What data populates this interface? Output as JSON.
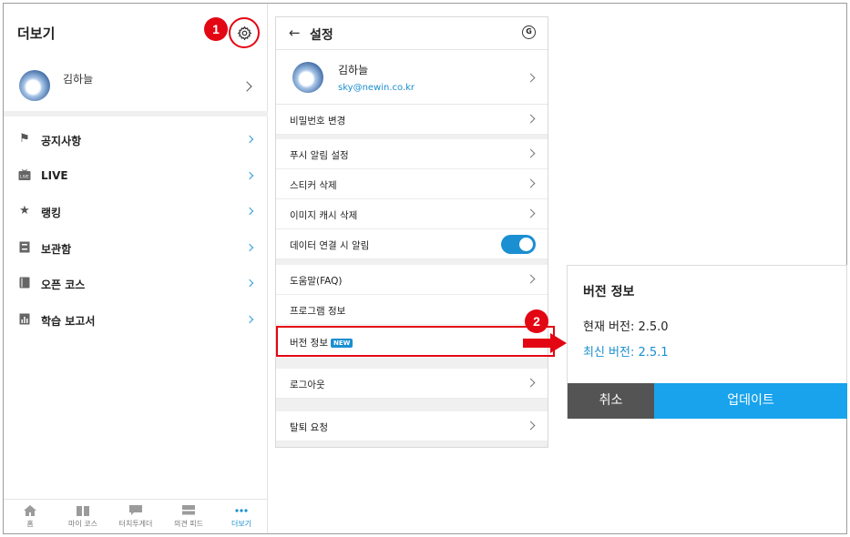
{
  "left": {
    "title": "더보기",
    "profile_name": "김하늘",
    "menu": [
      {
        "label": "공지사항",
        "icon": "flag-icon"
      },
      {
        "label": "LIVE",
        "icon": "live-icon"
      },
      {
        "label": "랭킹",
        "icon": "star-icon"
      },
      {
        "label": "보관함",
        "icon": "archive-icon"
      },
      {
        "label": "오픈 코스",
        "icon": "book-icon"
      },
      {
        "label": "학습 보고서",
        "icon": "report-icon"
      }
    ],
    "tabs": [
      {
        "label": "홈",
        "icon": "home-icon"
      },
      {
        "label": "마이 코스",
        "icon": "book-open-icon"
      },
      {
        "label": "터치투게더",
        "icon": "chat-icon"
      },
      {
        "label": "의견 피드",
        "icon": "feed-icon"
      },
      {
        "label": "더보기",
        "icon": "more-icon"
      }
    ]
  },
  "badges": {
    "one": "1",
    "two": "2"
  },
  "settings": {
    "title": "설정",
    "back_icon": "back-arrow-icon",
    "g_label": "G",
    "profile_name": "김하늘",
    "profile_email": "sky@newin.co.kr",
    "rows": {
      "password": "비밀번호 변경",
      "push": "푸시 알림 설정",
      "sticker": "스티커 삭제",
      "cache": "이미지 캐시 삭제",
      "data_alert": "데이터 연결 시 알림",
      "faq": "도움말(FAQ)",
      "program": "프로그램 정보",
      "version": "버전 정보",
      "new_tag": "NEW",
      "logout": "로그아웃",
      "withdraw": "탈퇴 요청"
    },
    "data_alert_on": true
  },
  "dialog": {
    "title": "버전 정보",
    "current": "현재 버전: 2.5.0",
    "latest": "최신 버전: 2.5.1",
    "cancel": "취소",
    "update": "업데이트"
  },
  "colors": {
    "accent": "#1a8fd1",
    "highlight": "#e30613",
    "update_button": "#18a3ec",
    "cancel_button": "#545454"
  }
}
